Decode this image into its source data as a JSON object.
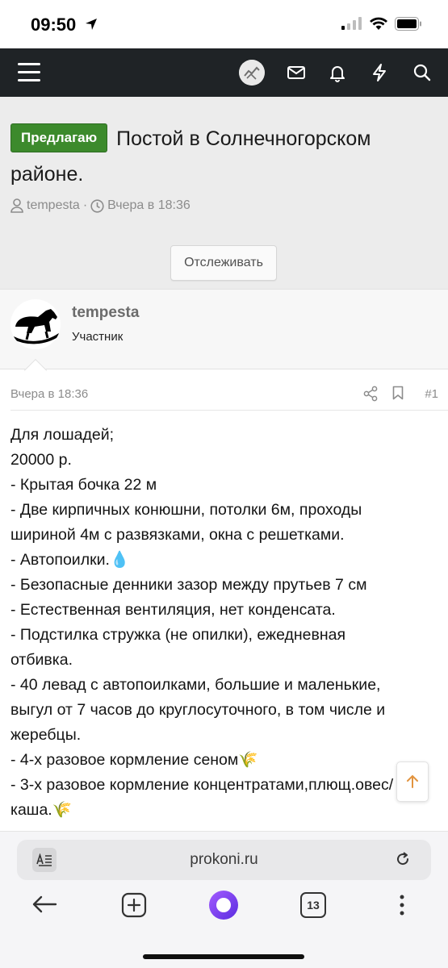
{
  "status_bar": {
    "time": "09:50"
  },
  "navbar": {
    "icons": [
      "menu-icon",
      "avatar",
      "mail-icon",
      "bell-icon",
      "lightning-icon",
      "search-icon"
    ]
  },
  "thread": {
    "prefix": "Предлагаю",
    "title": "Постой в Солнечногорском районе.",
    "author": "tempesta",
    "separator": "·",
    "date": "Вчера в 18:36",
    "watch_label": "Отслеживать"
  },
  "user": {
    "name": "tempesta",
    "role": "Участник"
  },
  "post": {
    "date": "Вчера в 18:36",
    "number": "#1",
    "lines": [
      "Для лошадей;",
      "20000 р.",
      "- Крытая бочка 22 м",
      "- Две кирпичных конюшни, потолки 6м, проходы",
      "шириной 4м с развязками, окна с решетками.",
      "- Автопоилки.",
      "- Безопасные денники зазор между прутьев 7 см",
      "- Естественная вентиляция, нет конденсата.",
      "- Подстилка стружка (не опилки), ежедневная",
      "отбивка.",
      "- 40 левад с автопоилками, большие и маленькие,",
      "выгул от 7 часов до круглосуточного, в том числе и",
      "жеребцы.",
      "- 4-х разовое кормление сеном",
      "- 3-х разовое кормление концентратами,плющ.овес/",
      "каша."
    ],
    "emoji": {
      "droplet": "💧",
      "grain": "🌾"
    }
  },
  "browser": {
    "url": "prokoni.ru",
    "tab_count": "13"
  },
  "colors": {
    "navbar_bg": "#1f2326",
    "prefix_green": "#3c8a2c",
    "header_bg": "#ececec",
    "alice_purple": "#7b3cf0"
  }
}
